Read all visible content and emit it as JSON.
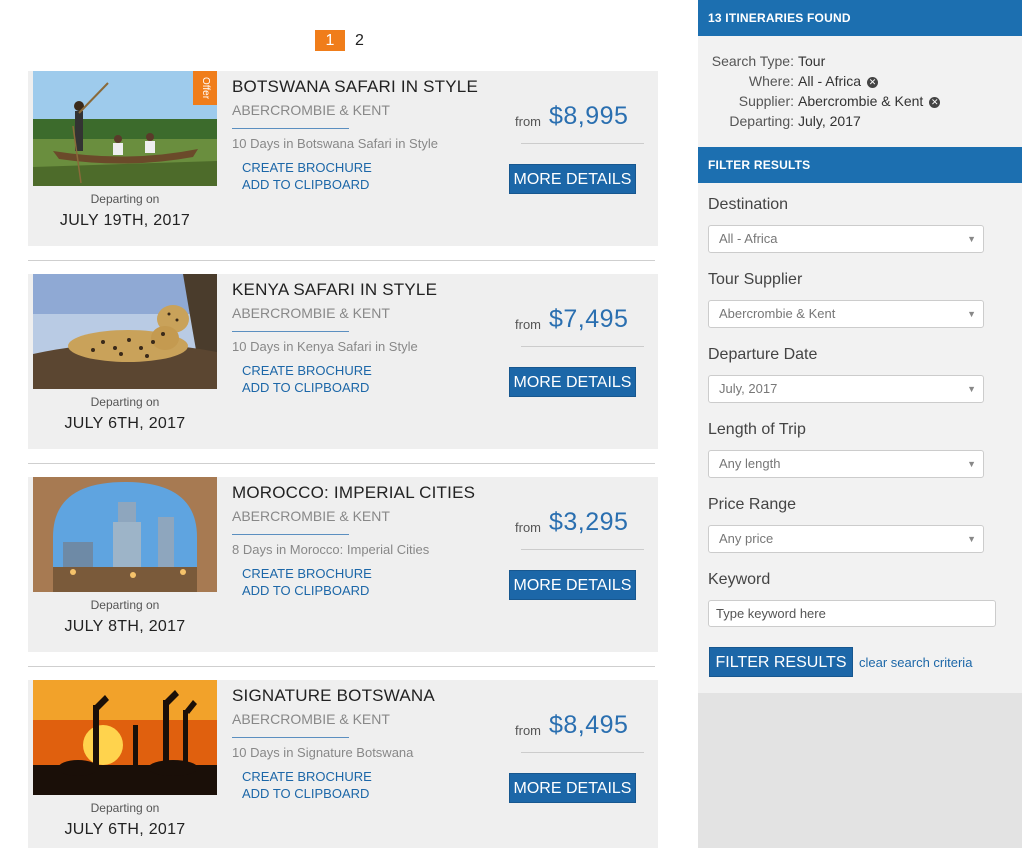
{
  "pagination": {
    "pages": [
      "1",
      "2"
    ],
    "current": "1"
  },
  "tours": [
    {
      "title": "Botswana Safari in Style",
      "supplier": "Abercrombie & Kent",
      "description": "10 Days in Botswana Safari in Style",
      "price_from": "from",
      "price": "$8,995",
      "departing_label": "Departing on",
      "departing_date": "JULY 19TH, 2017",
      "offer": "Offer",
      "brochure_link": "Create Brochure",
      "clipboard_link": "Add to Clipboard",
      "details_button": "MORE DETAILS"
    },
    {
      "title": "Kenya Safari in Style",
      "supplier": "Abercrombie & Kent",
      "description": "10 Days in Kenya Safari in Style",
      "price_from": "from",
      "price": "$7,495",
      "departing_label": "Departing on",
      "departing_date": "JULY 6TH, 2017",
      "brochure_link": "Create Brochure",
      "clipboard_link": "Add to Clipboard",
      "details_button": "MORE DETAILS"
    },
    {
      "title": "Morocco: Imperial Cities",
      "supplier": "Abercrombie & Kent",
      "description": "8 Days in Morocco: Imperial Cities",
      "price_from": "from",
      "price": "$3,295",
      "departing_label": "Departing on",
      "departing_date": "JULY 8TH, 2017",
      "brochure_link": "Create Brochure",
      "clipboard_link": "Add to Clipboard",
      "details_button": "MORE DETAILS"
    },
    {
      "title": "Signature Botswana",
      "supplier": "Abercrombie & Kent",
      "description": "10 Days in Signature Botswana",
      "price_from": "from",
      "price": "$8,495",
      "departing_label": "Departing on",
      "departing_date": "JULY 6TH, 2017",
      "brochure_link": "Create Brochure",
      "clipboard_link": "Add to Clipboard",
      "details_button": "MORE DETAILS"
    }
  ],
  "sidebar": {
    "results_header": "13 Itineraries Found",
    "search": {
      "type_label": "Search Type:",
      "type_value": "Tour",
      "where_label": "Where:",
      "where_value": "All - Africa",
      "supplier_label": "Supplier:",
      "supplier_value": "Abercrombie & Kent",
      "departing_label": "Departing:",
      "departing_value": "July, 2017"
    },
    "filter_header": "Filter Results",
    "filters": {
      "destination_label": "Destination",
      "destination_value": "All - Africa",
      "supplier_label": "Tour Supplier",
      "supplier_value": "Abercrombie & Kent",
      "date_label": "Departure Date",
      "date_value": "July, 2017",
      "length_label": "Length of Trip",
      "length_value": "Any length",
      "price_label": "Price Range",
      "price_value": "Any price",
      "keyword_label": "Keyword",
      "keyword_placeholder": "Type keyword here"
    },
    "filter_button": "Filter Results",
    "clear_link": "clear search criteria"
  },
  "colors": {
    "accent_blue": "#1c67a8",
    "offer_orange": "#f07d1a",
    "header_blue": "#1c6fb0"
  }
}
